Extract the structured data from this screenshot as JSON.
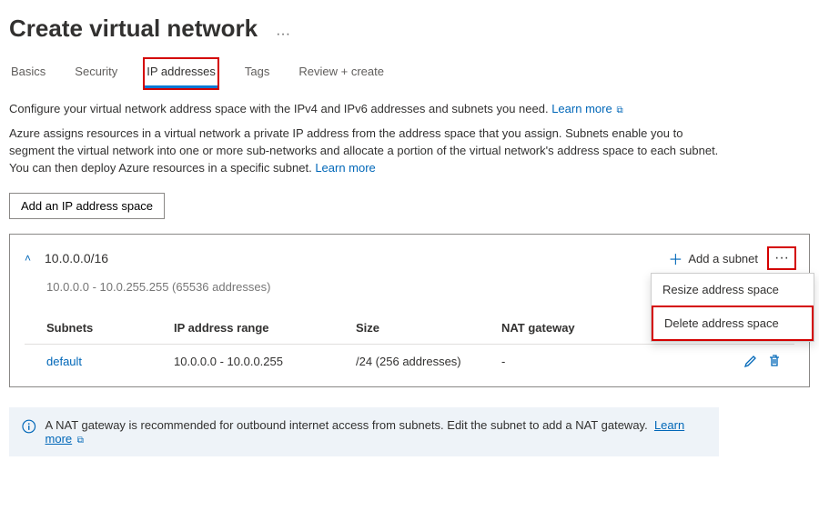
{
  "header": {
    "title": "Create virtual network"
  },
  "tabs": {
    "items": [
      {
        "label": "Basics"
      },
      {
        "label": "Security"
      },
      {
        "label": "IP addresses"
      },
      {
        "label": "Tags"
      },
      {
        "label": "Review + create"
      }
    ]
  },
  "descriptions": {
    "line1": "Configure your virtual network address space with the IPv4 and IPv6 addresses and subnets you need.",
    "learn1": "Learn more",
    "line2": "Azure assigns resources in a virtual network a private IP address from the address space that you assign. Subnets enable you to segment the virtual network into one or more sub-networks and allocate a portion of the virtual network's address space to each subnet. You can then deploy Azure resources in a specific subnet.",
    "learn2": "Learn more"
  },
  "buttons": {
    "add_space": "Add an IP address space",
    "add_subnet": "Add a subnet"
  },
  "space": {
    "cidr": "10.0.0.0/16",
    "range": "10.0.0.0 - 10.0.255.255 (65536 addresses)",
    "menu": {
      "resize": "Resize address space",
      "delete": "Delete address space"
    }
  },
  "table": {
    "headers": {
      "subnets": "Subnets",
      "range": "IP address range",
      "size": "Size",
      "nat": "NAT gateway"
    },
    "row": {
      "name": "default",
      "range": "10.0.0.0 - 10.0.0.255",
      "size": "/24 (256 addresses)",
      "nat": "-"
    }
  },
  "info": {
    "text": "A NAT gateway is recommended for outbound internet access from subnets. Edit the subnet to add a NAT gateway.",
    "learn": "Learn more"
  }
}
